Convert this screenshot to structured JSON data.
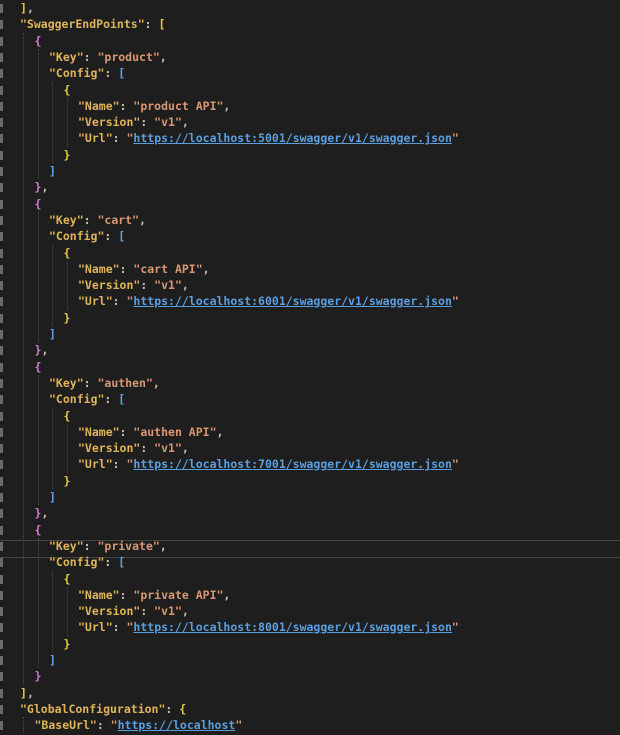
{
  "editor": {
    "lines": [
      {
        "i": 0,
        "t": [
          [
            "]",
            "br-y"
          ],
          [
            ",",
            "pun"
          ]
        ]
      },
      {
        "i": 0,
        "t": [
          [
            "\"SwaggerEndPoints\"",
            "key"
          ],
          [
            ": ",
            "pun"
          ],
          [
            "[",
            "br-y"
          ]
        ]
      },
      {
        "i": 1,
        "t": [
          [
            "{",
            "br-p"
          ]
        ]
      },
      {
        "i": 2,
        "t": [
          [
            "\"Key\"",
            "key"
          ],
          [
            ": ",
            "pun"
          ],
          [
            "\"product\"",
            "str"
          ],
          [
            ",",
            "pun"
          ]
        ]
      },
      {
        "i": 2,
        "t": [
          [
            "\"Config\"",
            "key"
          ],
          [
            ": ",
            "pun"
          ],
          [
            "[",
            "br-b"
          ]
        ]
      },
      {
        "i": 3,
        "t": [
          [
            "{",
            "br-y"
          ]
        ]
      },
      {
        "i": 4,
        "t": [
          [
            "\"Name\"",
            "key"
          ],
          [
            ": ",
            "pun"
          ],
          [
            "\"product API\"",
            "str"
          ],
          [
            ",",
            "pun"
          ]
        ]
      },
      {
        "i": 4,
        "t": [
          [
            "\"Version\"",
            "key"
          ],
          [
            ": ",
            "pun"
          ],
          [
            "\"v1\"",
            "str"
          ],
          [
            ",",
            "pun"
          ]
        ]
      },
      {
        "i": 4,
        "t": [
          [
            "\"Url\"",
            "key"
          ],
          [
            ": ",
            "pun"
          ],
          [
            "\"",
            "str"
          ],
          [
            "https://localhost:5001/swagger/v1/swagger.json",
            "url"
          ],
          [
            "\"",
            "str"
          ]
        ]
      },
      {
        "i": 3,
        "t": [
          [
            "}",
            "br-y"
          ]
        ]
      },
      {
        "i": 2,
        "t": [
          [
            "]",
            "br-b"
          ]
        ]
      },
      {
        "i": 1,
        "t": [
          [
            "}",
            "br-p"
          ],
          [
            ",",
            "pun"
          ]
        ]
      },
      {
        "i": 1,
        "t": [
          [
            "{",
            "br-p"
          ]
        ]
      },
      {
        "i": 2,
        "t": [
          [
            "\"Key\"",
            "key"
          ],
          [
            ": ",
            "pun"
          ],
          [
            "\"cart\"",
            "str"
          ],
          [
            ",",
            "pun"
          ]
        ]
      },
      {
        "i": 2,
        "t": [
          [
            "\"Config\"",
            "key"
          ],
          [
            ": ",
            "pun"
          ],
          [
            "[",
            "br-b"
          ]
        ]
      },
      {
        "i": 3,
        "t": [
          [
            "{",
            "br-y"
          ]
        ]
      },
      {
        "i": 4,
        "t": [
          [
            "\"Name\"",
            "key"
          ],
          [
            ": ",
            "pun"
          ],
          [
            "\"cart API\"",
            "str"
          ],
          [
            ",",
            "pun"
          ]
        ]
      },
      {
        "i": 4,
        "t": [
          [
            "\"Version\"",
            "key"
          ],
          [
            ": ",
            "pun"
          ],
          [
            "\"v1\"",
            "str"
          ],
          [
            ",",
            "pun"
          ]
        ]
      },
      {
        "i": 4,
        "t": [
          [
            "\"Url\"",
            "key"
          ],
          [
            ": ",
            "pun"
          ],
          [
            "\"",
            "str"
          ],
          [
            "https://localhost:6001/swagger/v1/swagger.json",
            "url"
          ],
          [
            "\"",
            "str"
          ]
        ]
      },
      {
        "i": 3,
        "t": [
          [
            "}",
            "br-y"
          ]
        ]
      },
      {
        "i": 2,
        "t": [
          [
            "]",
            "br-b"
          ]
        ]
      },
      {
        "i": 1,
        "t": [
          [
            "}",
            "br-p"
          ],
          [
            ",",
            "pun"
          ]
        ]
      },
      {
        "i": 1,
        "t": [
          [
            "{",
            "br-p"
          ]
        ]
      },
      {
        "i": 2,
        "t": [
          [
            "\"Key\"",
            "key"
          ],
          [
            ": ",
            "pun"
          ],
          [
            "\"authen\"",
            "str"
          ],
          [
            ",",
            "pun"
          ]
        ]
      },
      {
        "i": 2,
        "t": [
          [
            "\"Config\"",
            "key"
          ],
          [
            ": ",
            "pun"
          ],
          [
            "[",
            "br-b"
          ]
        ]
      },
      {
        "i": 3,
        "t": [
          [
            "{",
            "br-y"
          ]
        ]
      },
      {
        "i": 4,
        "t": [
          [
            "\"Name\"",
            "key"
          ],
          [
            ": ",
            "pun"
          ],
          [
            "\"authen API\"",
            "str"
          ],
          [
            ",",
            "pun"
          ]
        ]
      },
      {
        "i": 4,
        "t": [
          [
            "\"Version\"",
            "key"
          ],
          [
            ": ",
            "pun"
          ],
          [
            "\"v1\"",
            "str"
          ],
          [
            ",",
            "pun"
          ]
        ]
      },
      {
        "i": 4,
        "t": [
          [
            "\"Url\"",
            "key"
          ],
          [
            ": ",
            "pun"
          ],
          [
            "\"",
            "str"
          ],
          [
            "https://localhost:7001/swagger/v1/swagger.json",
            "url"
          ],
          [
            "\"",
            "str"
          ]
        ]
      },
      {
        "i": 3,
        "t": [
          [
            "}",
            "br-y"
          ]
        ]
      },
      {
        "i": 2,
        "t": [
          [
            "]",
            "br-b"
          ]
        ]
      },
      {
        "i": 1,
        "t": [
          [
            "}",
            "br-p"
          ],
          [
            ",",
            "pun"
          ]
        ]
      },
      {
        "i": 1,
        "t": [
          [
            "{",
            "br-p"
          ]
        ]
      },
      {
        "i": 2,
        "t": [
          [
            "\"Key\"",
            "key"
          ],
          [
            ": ",
            "pun"
          ],
          [
            "\"private\"",
            "str"
          ],
          [
            ",",
            "pun"
          ]
        ]
      },
      {
        "i": 2,
        "t": [
          [
            "\"Config\"",
            "key"
          ],
          [
            ": ",
            "pun"
          ],
          [
            "[",
            "br-b"
          ]
        ]
      },
      {
        "i": 3,
        "t": [
          [
            "{",
            "br-y"
          ]
        ]
      },
      {
        "i": 4,
        "t": [
          [
            "\"Name\"",
            "key"
          ],
          [
            ": ",
            "pun"
          ],
          [
            "\"private API\"",
            "str"
          ],
          [
            ",",
            "pun"
          ]
        ]
      },
      {
        "i": 4,
        "t": [
          [
            "\"Version\"",
            "key"
          ],
          [
            ": ",
            "pun"
          ],
          [
            "\"v1\"",
            "str"
          ],
          [
            ",",
            "pun"
          ]
        ]
      },
      {
        "i": 4,
        "t": [
          [
            "\"Url\"",
            "key"
          ],
          [
            ": ",
            "pun"
          ],
          [
            "\"",
            "str"
          ],
          [
            "https://localhost:8001/swagger/v1/swagger.json",
            "url"
          ],
          [
            "\"",
            "str"
          ]
        ]
      },
      {
        "i": 3,
        "t": [
          [
            "}",
            "br-y"
          ]
        ]
      },
      {
        "i": 2,
        "t": [
          [
            "]",
            "br-b"
          ]
        ]
      },
      {
        "i": 1,
        "t": [
          [
            "}",
            "br-p"
          ]
        ]
      },
      {
        "i": 0,
        "t": [
          [
            "]",
            "br-y"
          ],
          [
            ",",
            "pun"
          ]
        ]
      },
      {
        "i": 0,
        "t": [
          [
            "\"GlobalConfiguration\"",
            "key"
          ],
          [
            ": ",
            "pun"
          ],
          [
            "{",
            "br-y"
          ]
        ]
      },
      {
        "i": 1,
        "t": [
          [
            "\"BaseUrl\"",
            "key"
          ],
          [
            ": ",
            "pun"
          ],
          [
            "\"",
            "str"
          ],
          [
            "https://localhost",
            "url"
          ],
          [
            "\"",
            "str"
          ]
        ]
      }
    ]
  }
}
